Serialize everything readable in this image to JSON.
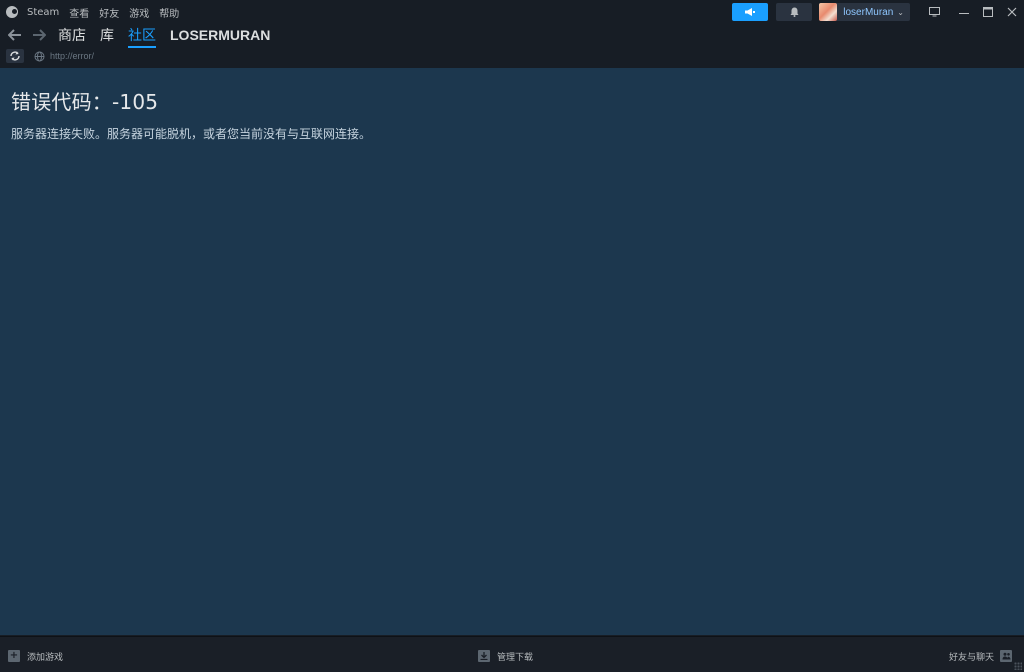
{
  "menu": {
    "app_name": "Steam",
    "items": [
      "查看",
      "好友",
      "游戏",
      "帮助"
    ]
  },
  "user": {
    "name": "loserMuran"
  },
  "nav": {
    "tabs": [
      {
        "label": "商店"
      },
      {
        "label": "库"
      },
      {
        "label": "社区"
      },
      {
        "label": "LOSERMURAN"
      }
    ],
    "active_tab": "社区",
    "url": "http://error/"
  },
  "content": {
    "error_title": "错误代码：-105",
    "error_message": "服务器连接失败。服务器可能脱机，或者您当前没有与互联网连接。"
  },
  "bottom": {
    "add_game": "添加游戏",
    "manage_downloads": "管理下载",
    "friends_chat": "好友与聊天"
  },
  "colors": {
    "accent": "#1a9fff",
    "content_bg": "#1c374e",
    "chrome_bg": "#171d25"
  }
}
